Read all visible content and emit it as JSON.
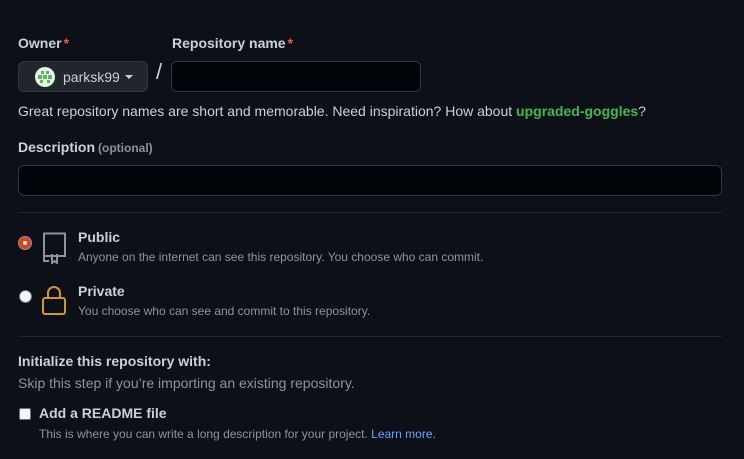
{
  "owner": {
    "label": "Owner",
    "required_mark": "*",
    "selected": "parksk99"
  },
  "separator": "/",
  "repo_name": {
    "label": "Repository name",
    "required_mark": "*",
    "value": "",
    "placeholder": ""
  },
  "name_hint": {
    "text": "Great repository names are short and memorable. Need inspiration? How about ",
    "suggestion": "upgraded-goggles",
    "suffix": "?"
  },
  "description": {
    "label": "Description",
    "optional_note": "(optional)",
    "value": "",
    "placeholder": ""
  },
  "visibility": {
    "selected": "public",
    "options": [
      {
        "id": "public",
        "title": "Public",
        "description": "Anyone on the internet can see this repository. You choose who can commit.",
        "icon": "repo-icon"
      },
      {
        "id": "private",
        "title": "Private",
        "description": "You choose who can see and commit to this repository.",
        "icon": "lock-icon"
      }
    ]
  },
  "initialize": {
    "title": "Initialize this repository with:",
    "subtitle": "Skip this step if you’re importing an existing repository.",
    "readme": {
      "label": "Add a README file",
      "checked": false,
      "description": "This is where you can write a long description for your project. ",
      "link": "Learn more."
    }
  },
  "colors": {
    "background": "#0d1117",
    "required": "#f85149",
    "suggestion": "#3fb950",
    "link": "#58a6ff",
    "lock_icon": "#d29922",
    "radio_selected": "#e0411b"
  }
}
